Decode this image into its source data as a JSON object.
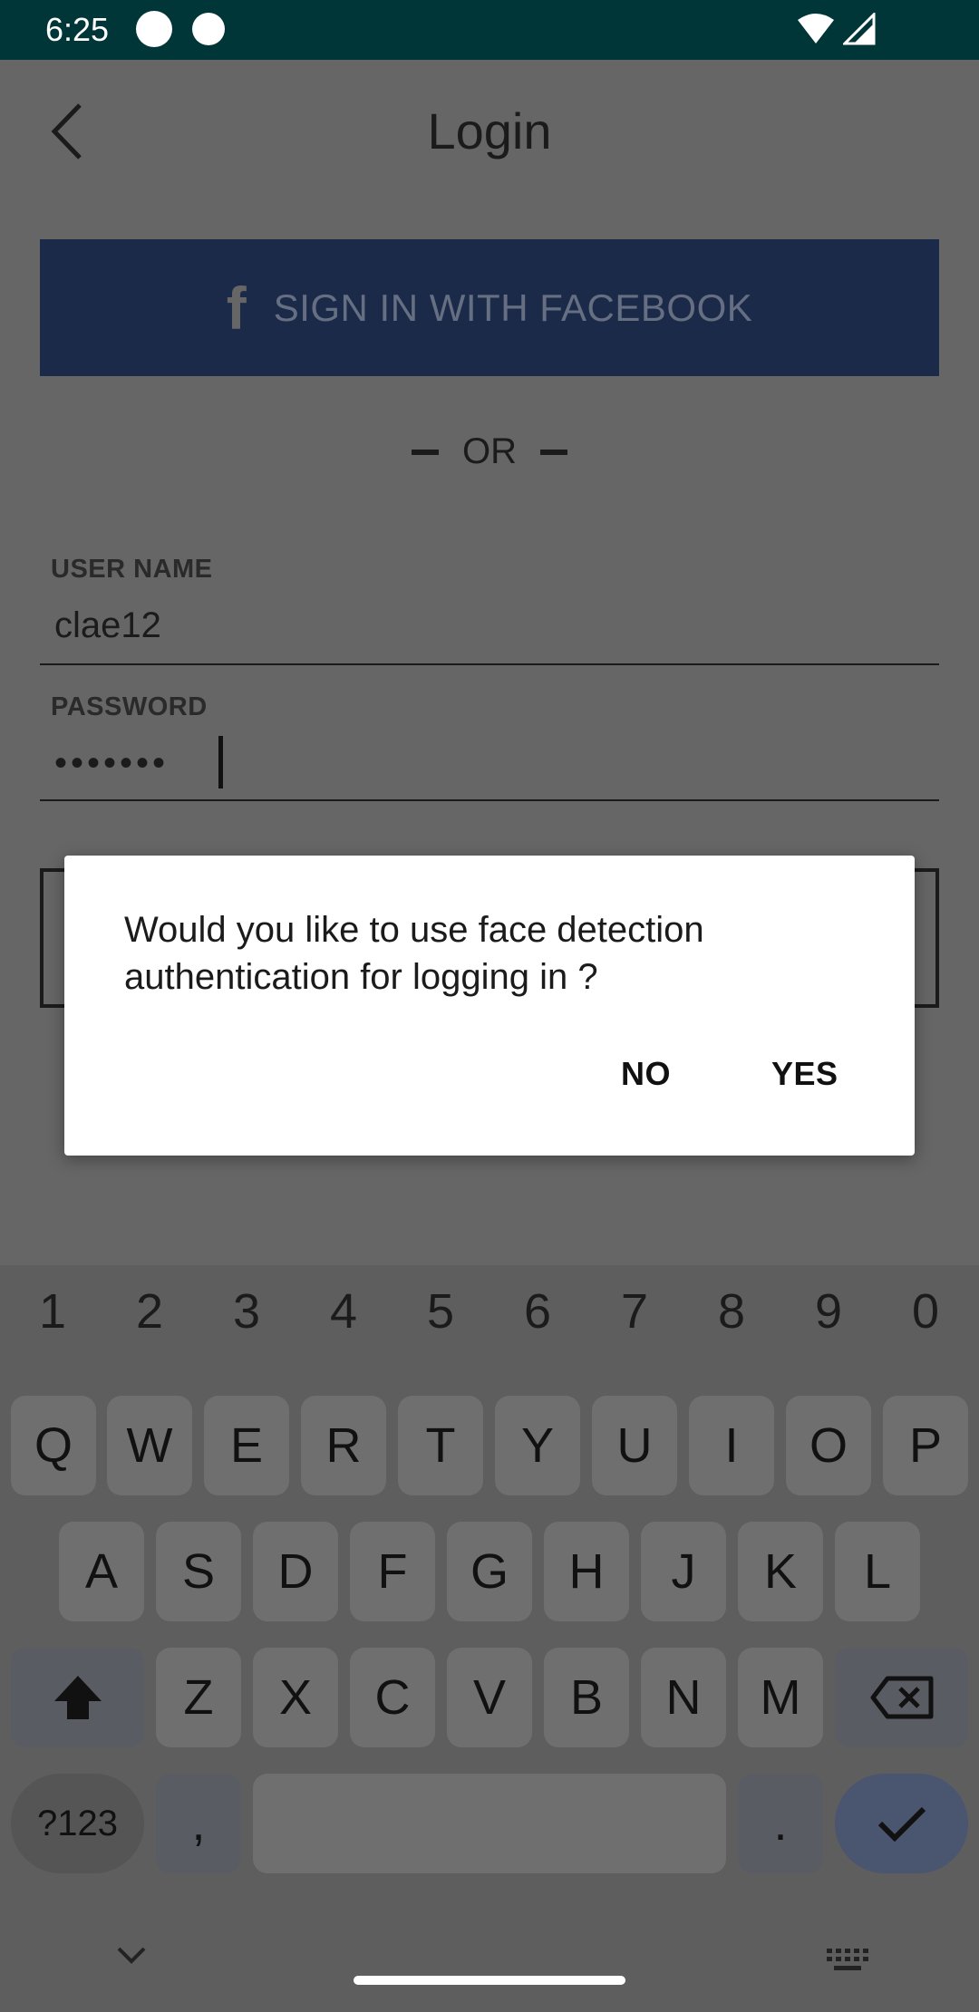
{
  "status_bar": {
    "time": "6:25"
  },
  "header": {
    "title": "Login"
  },
  "facebook": {
    "icon": "f",
    "label": "SIGN IN WITH FACEBOOK"
  },
  "divider": {
    "text": "OR"
  },
  "form": {
    "username_label": "USER NAME",
    "username_value": "clae12",
    "password_label": "PASSWORD",
    "password_value": "•••••••"
  },
  "dialog": {
    "message": "Would you like to use face detection authentication for logging in ?",
    "no_label": "NO",
    "yes_label": "YES"
  },
  "keyboard": {
    "numbers": [
      "1",
      "2",
      "3",
      "4",
      "5",
      "6",
      "7",
      "8",
      "9",
      "0"
    ],
    "row1": [
      "Q",
      "W",
      "E",
      "R",
      "T",
      "Y",
      "U",
      "I",
      "O",
      "P"
    ],
    "row2": [
      "A",
      "S",
      "D",
      "F",
      "G",
      "H",
      "J",
      "K",
      "L"
    ],
    "row3": [
      "Z",
      "X",
      "C",
      "V",
      "B",
      "N",
      "M"
    ],
    "symbols_label": "?123",
    "comma_label": ",",
    "period_label": ".",
    "icons": {
      "shift": "shift-icon",
      "backspace": "backspace-icon",
      "enter": "check-icon",
      "hide": "chevron-down-icon",
      "layout": "keyboard-icon"
    }
  },
  "colors": {
    "status_bar": "#003638",
    "scrim": "#666666",
    "facebook": "#1c2a4a",
    "dialog": "#ffffff",
    "keyboard": "#5e5e5e",
    "enter_key": "#4a5570"
  }
}
